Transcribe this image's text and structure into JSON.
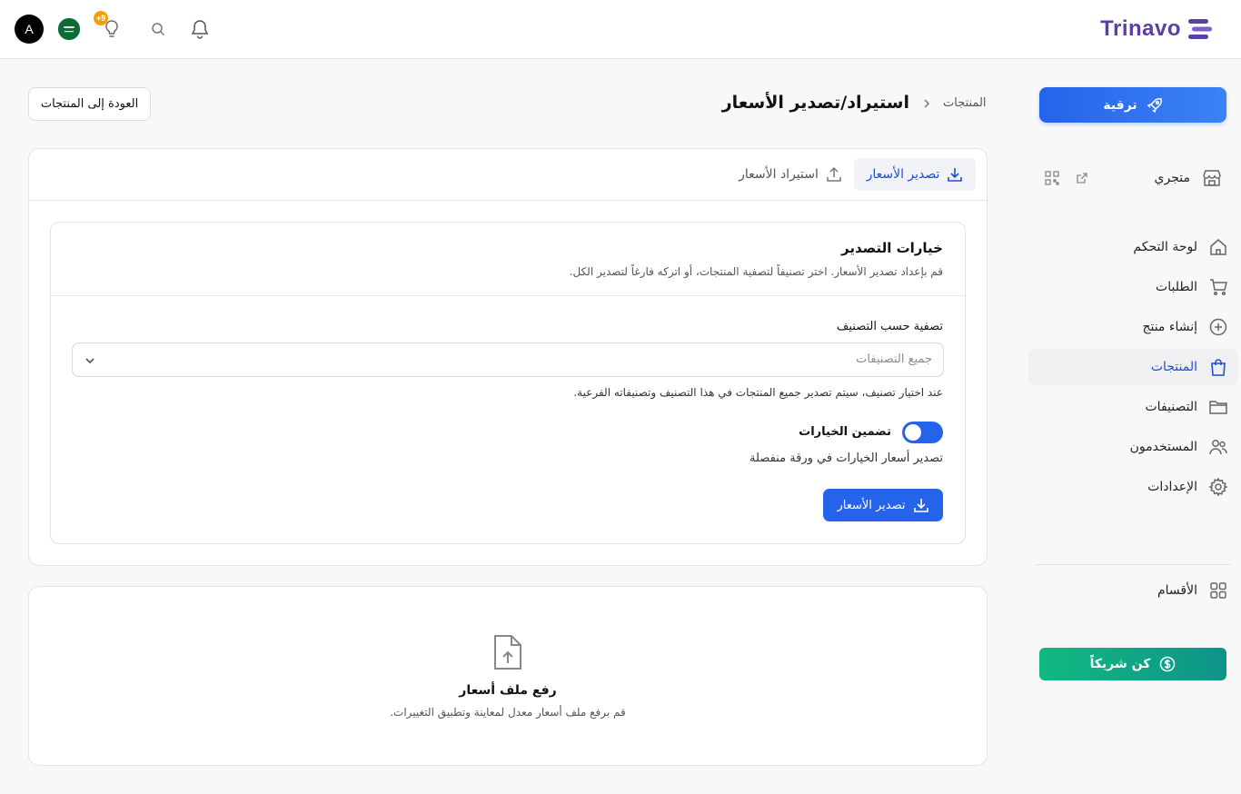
{
  "brand": {
    "name": "Trinavo",
    "color": "#5b3fa3"
  },
  "topbar": {
    "avatar_initial": "A",
    "notification_badge": "+9",
    "icons": [
      "flag-icon",
      "lightbulb-icon",
      "search-icon",
      "bell-icon"
    ]
  },
  "sidebar": {
    "upgrade_label": "ترقية",
    "store_label": "متجري",
    "items": [
      {
        "label": "لوحة التحكم",
        "icon": "home-icon"
      },
      {
        "label": "الطلبات",
        "icon": "cart-icon"
      },
      {
        "label": "إنشاء منتج",
        "icon": "plus-circle-icon"
      },
      {
        "label": "المنتجات",
        "icon": "bag-icon",
        "active": true
      },
      {
        "label": "التصنيفات",
        "icon": "folder-icon"
      },
      {
        "label": "المستخدمون",
        "icon": "users-icon"
      },
      {
        "label": "الإعدادات",
        "icon": "gear-icon"
      }
    ],
    "sections_label": "الأقسام",
    "partner_label": "كن شريكاً"
  },
  "header": {
    "breadcrumb_root": "المنتجات",
    "title": "استيراد/تصدير الأسعار",
    "back_label": "العودة إلى المنتجات"
  },
  "tabs": {
    "export_label": "تصدير الأسعار",
    "import_label": "استيراد الأسعار"
  },
  "export_options": {
    "title": "خيارات التصدير",
    "subtitle": "قم بإعداد تصدير الأسعار. اختر تصنيفاً لتصفية المنتجات، أو اتركه فارغاً لتصدير الكل.",
    "filter_label": "تصفية حسب التصنيف",
    "filter_placeholder": "جميع التصنيفات",
    "filter_hint": "عند اختيار تصنيف، سيتم تصدير جميع المنتجات في هذا التصنيف وتصنيفاته الفرعية.",
    "include_variants_label": "تضمين الخيارات",
    "include_variants_on": true,
    "include_variants_desc": "تصدير أسعار الخيارات في ورقة منفصلة",
    "export_button": "تصدير الأسعار"
  },
  "upload": {
    "title": "رفع ملف أسعار",
    "subtitle": "قم برفع ملف أسعار معدل لمعاينة وتطبيق التغييرات."
  },
  "colors": {
    "primary": "#2563eb",
    "partner": "#10b981",
    "badge": "#f59e0b"
  }
}
